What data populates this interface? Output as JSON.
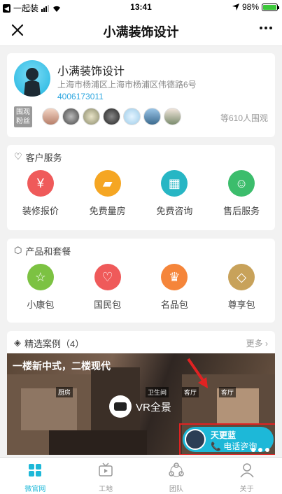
{
  "status": {
    "carrier": "一起装",
    "time": "13:41",
    "battery": "98%",
    "battery_level": 0.98,
    "back_glyph": "◀"
  },
  "nav": {
    "title": "小满装饰设计"
  },
  "profile": {
    "name": "小满装饰设计",
    "address": "上海市杨浦区上海市杨浦区伟德路6号",
    "phone": "4006173011",
    "fans_badge": "围观粉丝",
    "fans_count": "等610人围观"
  },
  "service": {
    "title": "客户服务",
    "items": [
      {
        "label": "装修报价",
        "icon": "yen-icon",
        "color": "#ef5a5a",
        "glyph": "¥"
      },
      {
        "label": "免费量房",
        "icon": "ruler-icon",
        "color": "#f5a623",
        "glyph": "▰"
      },
      {
        "label": "免费咨询",
        "icon": "calendar-icon",
        "color": "#27b6c4",
        "glyph": "▦"
      },
      {
        "label": "售后服务",
        "icon": "bag-icon",
        "color": "#3cbd6c",
        "glyph": "☺"
      }
    ]
  },
  "package": {
    "title": "产品和套餐",
    "items": [
      {
        "label": "小康包",
        "icon": "star-icon",
        "color": "#7cc242",
        "glyph": "☆"
      },
      {
        "label": "国民包",
        "icon": "heart-icon",
        "color": "#ef5a5a",
        "glyph": "♡"
      },
      {
        "label": "名品包",
        "icon": "crown-icon",
        "color": "#f5853a",
        "glyph": "♛"
      },
      {
        "label": "尊享包",
        "icon": "diamond-icon",
        "color": "#c8a25a",
        "glyph": "◇"
      }
    ]
  },
  "cases": {
    "title": "精选案例（4）",
    "more": "更多 ›",
    "banner_title": "一楼新中式，二楼现代",
    "room_tags": [
      "厨房",
      "卫生间",
      "客厅",
      "客厅"
    ],
    "vr_label": "VR全景",
    "consultant_name": "天更蓝",
    "consult_label": "📞 电话咨询"
  },
  "tabs": [
    {
      "label": "微官网",
      "icon": "grid-icon",
      "active": true
    },
    {
      "label": "工地",
      "icon": "tv-icon",
      "active": false
    },
    {
      "label": "团队",
      "icon": "team-icon",
      "active": false
    },
    {
      "label": "关于",
      "icon": "person-icon",
      "active": false
    }
  ]
}
